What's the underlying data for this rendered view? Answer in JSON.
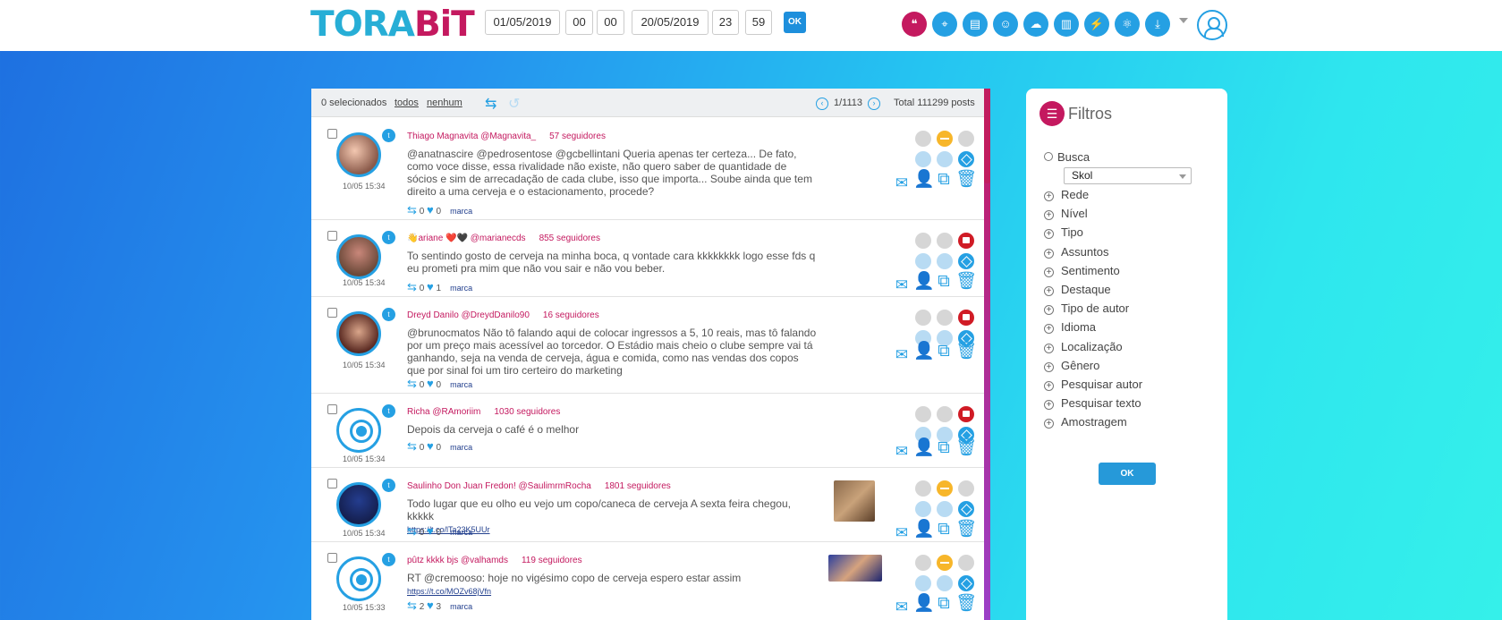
{
  "header": {
    "logo_part1": "TORA",
    "logo_part2": "BiT",
    "date_start": "01/05/2019",
    "hour_start": "00",
    "min_start": "00",
    "date_end": "20/05/2019",
    "hour_end": "23",
    "min_end": "59",
    "ok_label": "OK",
    "icons": [
      "quote-icon",
      "target-icon",
      "report-icon",
      "user-icon",
      "cloud-icon",
      "chart-icon",
      "lightning-icon",
      "network-icon",
      "download-icon"
    ]
  },
  "toolbar": {
    "selected": "0 selecionados",
    "all": "todos",
    "none": "nenhum",
    "page": "1/1113",
    "total": "Total 111299 posts"
  },
  "posts": [
    {
      "author": "Thiago Magnavita @Magnavita_",
      "followers": "57 seguidores",
      "text": "@anatnascire @pedrosentose @gcbellintani Queria apenas ter certeza... De fato, como voce disse, essa rivalidade não existe, não quero saber de quantidade de sócios e sim de arrecadação de cada clube, isso que importa... Soube ainda que tem direito a uma cerveja e o estacionamento, procede?",
      "link": "",
      "time": "10/05 15:34",
      "retweets": "0",
      "likes": "0",
      "tag": "marca",
      "sentiment": "neutral"
    },
    {
      "author": "👋ariane ❤️🖤 @marianecds",
      "followers": "855 seguidores",
      "text": "To sentindo gosto de cerveja na minha boca, q vontade cara kkkkkkkk logo esse fds q eu prometi pra mim que não vou sair e não vou beber.",
      "link": "",
      "time": "10/05 15:34",
      "retweets": "0",
      "likes": "1",
      "tag": "marca",
      "sentiment": "negative"
    },
    {
      "author": "Dreyd Danilo @DreydDanilo90",
      "followers": "16 seguidores",
      "text": "@brunocmatos Não tô falando aqui de colocar ingressos a 5, 10 reais, mas tô falando por um preço mais acessível ao torcedor. O Estádio mais cheio o clube sempre vai tá ganhando, seja na venda de cerveja, água e comida, como nas vendas dos copos que por sinal foi um tiro certeiro do marketing",
      "link": "",
      "time": "10/05 15:34",
      "retweets": "0",
      "likes": "0",
      "tag": "marca",
      "sentiment": "negative"
    },
    {
      "author": "Richa @RAmoriim",
      "followers": "1030 seguidores",
      "text": "Depois da cerveja o café é o melhor",
      "link": "",
      "time": "10/05 15:34",
      "retweets": "0",
      "likes": "0",
      "tag": "marca",
      "sentiment": "negative"
    },
    {
      "author": "Saulinho Don Juan Fredon! @SaulimrmRocha",
      "followers": "1801 seguidores",
      "text": "Todo lugar que eu olho eu vejo um copo/caneca de cerveja A sexta feira chegou, kkkkk",
      "link": "https://t.co/lTa23K5UUr",
      "time": "10/05 15:34",
      "retweets": "0",
      "likes": "0",
      "tag": "marca",
      "sentiment": "neutral"
    },
    {
      "author": "pûtz kkkk bjs @valhamds",
      "followers": "119 seguidores",
      "text": "RT @cremooso: hoje no vigésimo copo de cerveja espero estar assim",
      "link": "https://t.co/MOZv68jVfn",
      "time": "10/05 15:33",
      "retweets": "2",
      "likes": "3",
      "tag": "marca",
      "sentiment": "neutral"
    }
  ],
  "filters": {
    "title": "Filtros",
    "search_label": "Busca",
    "search_value": "Skol",
    "items": [
      "Rede",
      "Nível",
      "Tipo",
      "Assuntos",
      "Sentimento",
      "Destaque",
      "Tipo de autor",
      "Idioma",
      "Localização",
      "Gênero",
      "Pesquisar autor",
      "Pesquisar texto",
      "Amostragem"
    ],
    "ok_label": "OK"
  }
}
